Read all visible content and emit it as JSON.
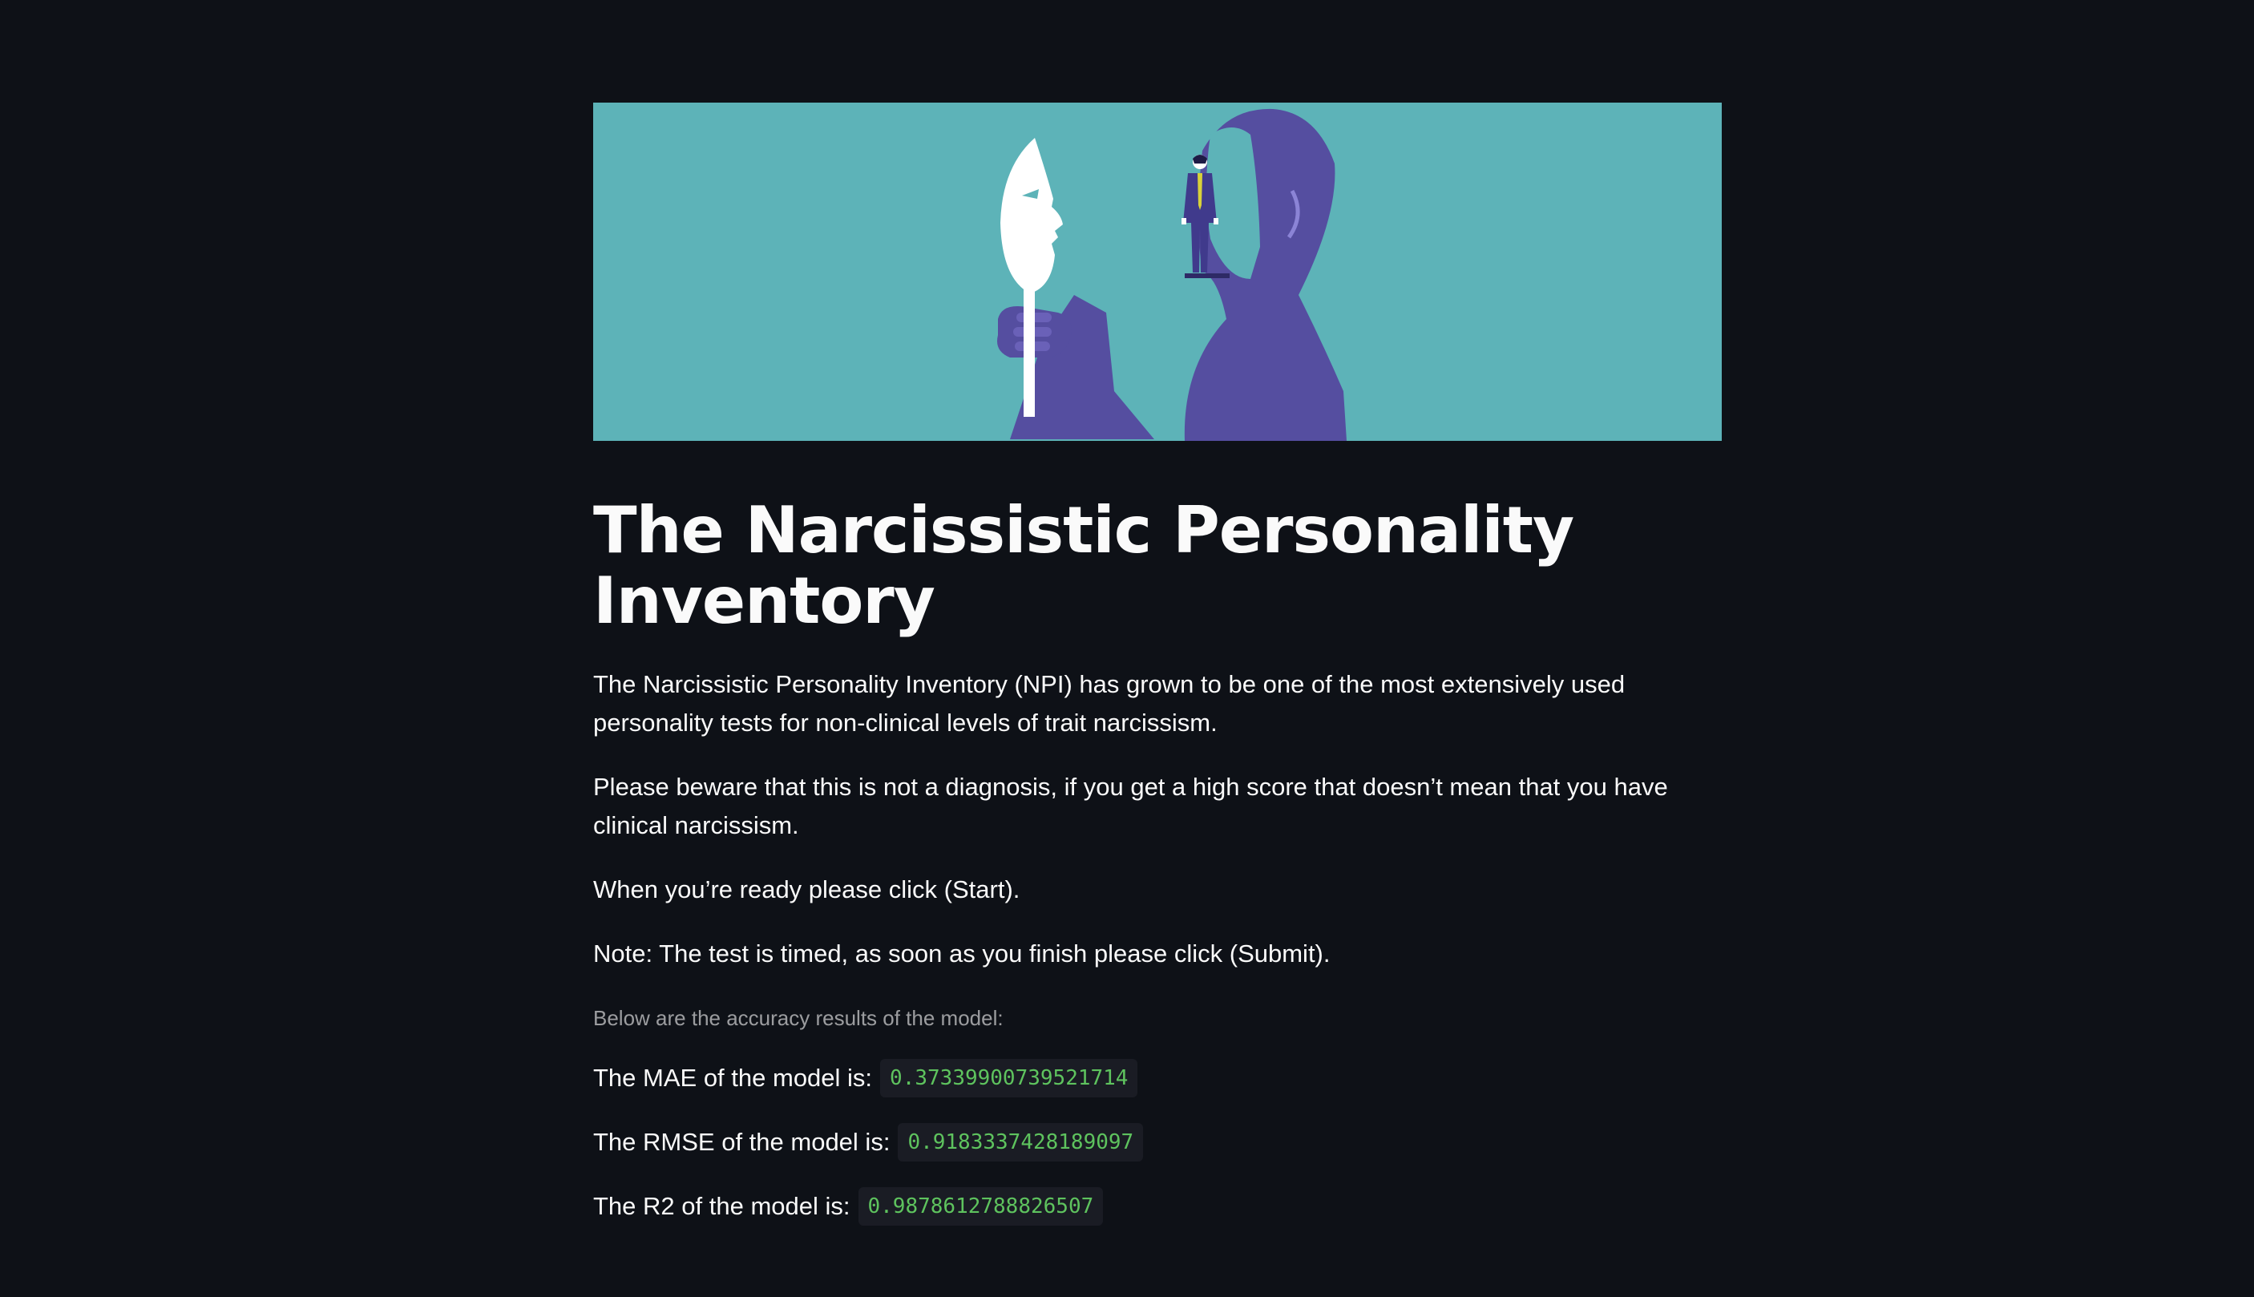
{
  "hero": {
    "image_name": "narcissism-mask-illustration",
    "colors": {
      "background": "#5db3b8",
      "figure": "#554ea0",
      "mask": "#ffffff",
      "tie": "#d8d13a"
    }
  },
  "page": {
    "title": "The Narcissistic Personality Inventory",
    "paragraphs": [
      "The Narcissistic Personality Inventory (NPI) has grown to be one of the most extensively used personality tests for non-clinical levels of trait narcissism.",
      "Please beware that this is not a diagnosis, if you get a high score that doesn’t mean that you have clinical narcissism.",
      "When you’re ready please click (Start).",
      "Note: The test is timed, as soon as you finish please click (Submit)."
    ],
    "caption": "Below are the accuracy results of the model:"
  },
  "metrics": [
    {
      "label": "The MAE of the model is:",
      "value": "0.37339900739521714"
    },
    {
      "label": "The RMSE of the model is:",
      "value": "0.9183337428189097"
    },
    {
      "label": "The R2 of the model is:",
      "value": "0.9878612788826507"
    }
  ],
  "theme": {
    "background": "#0e1117",
    "text": "#fafafa",
    "code_text": "#5ec35e",
    "code_bg": "#1a1c24"
  }
}
